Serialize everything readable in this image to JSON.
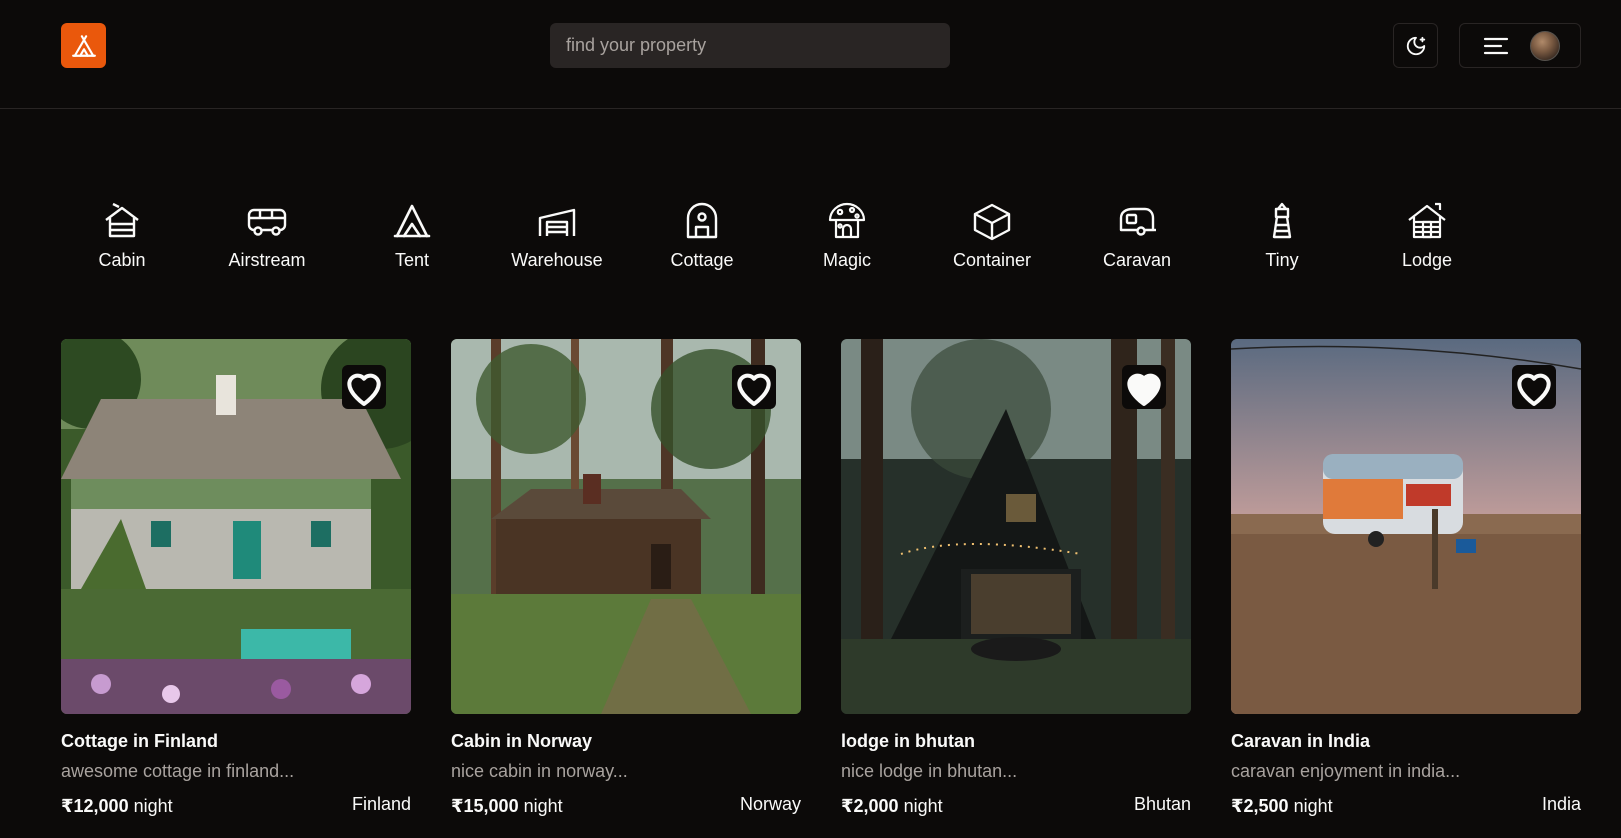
{
  "header": {
    "search_placeholder": "find your property",
    "logo_icon": "tent-icon",
    "theme_icon": "moon-stars-icon",
    "menu_icon": "hamburger-menu-icon",
    "brand_color": "#ea580c"
  },
  "categories": [
    {
      "label": "Cabin",
      "icon": "cabin-icon"
    },
    {
      "label": "Airstream",
      "icon": "van-icon"
    },
    {
      "label": "Tent",
      "icon": "tent-icon"
    },
    {
      "label": "Warehouse",
      "icon": "warehouse-icon"
    },
    {
      "label": "Cottage",
      "icon": "cottage-icon"
    },
    {
      "label": "Magic",
      "icon": "mushroom-house-icon"
    },
    {
      "label": "Container",
      "icon": "container-box-icon"
    },
    {
      "label": "Caravan",
      "icon": "caravan-icon"
    },
    {
      "label": "Tiny",
      "icon": "lighthouse-icon"
    },
    {
      "label": "Lodge",
      "icon": "lodge-icon"
    }
  ],
  "properties": [
    {
      "title": "Cottage in Finland",
      "description": "awesome cottage in finland...",
      "price": "₹12,000",
      "unit": "night",
      "country": "Finland",
      "favorited": false
    },
    {
      "title": "Cabin in Norway",
      "description": "nice cabin in norway...",
      "price": "₹15,000",
      "unit": "night",
      "country": "Norway",
      "favorited": false
    },
    {
      "title": "lodge in bhutan",
      "description": "nice lodge in bhutan...",
      "price": "₹2,000",
      "unit": "night",
      "country": "Bhutan",
      "favorited": true
    },
    {
      "title": "Caravan in India",
      "description": "caravan enjoyment in india...",
      "price": "₹2,500",
      "unit": "night",
      "country": "India",
      "favorited": false
    }
  ]
}
